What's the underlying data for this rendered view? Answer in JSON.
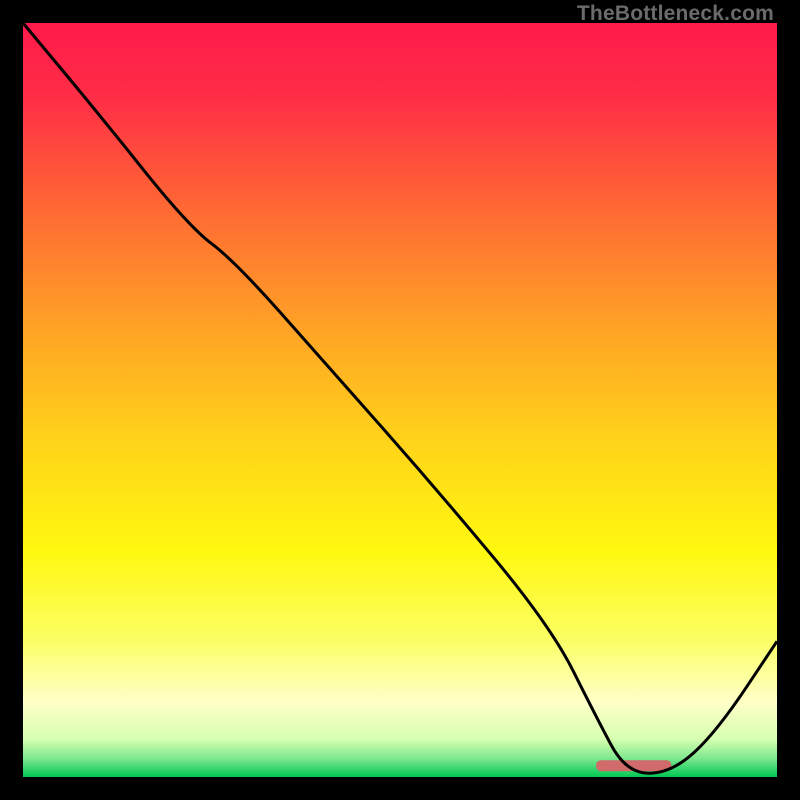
{
  "watermark": "TheBottleneck.com",
  "chart_data": {
    "type": "line",
    "title": "",
    "xlabel": "",
    "ylabel": "",
    "xlim": [
      0,
      100
    ],
    "ylim": [
      0,
      100
    ],
    "grid": false,
    "legend": false,
    "gradient_stops": [
      {
        "offset": 0.0,
        "color": "#ff1a4b"
      },
      {
        "offset": 0.1,
        "color": "#ff2e46"
      },
      {
        "offset": 0.25,
        "color": "#ff6a33"
      },
      {
        "offset": 0.4,
        "color": "#ffa126"
      },
      {
        "offset": 0.55,
        "color": "#ffd21a"
      },
      {
        "offset": 0.7,
        "color": "#fff80f"
      },
      {
        "offset": 0.82,
        "color": "#fbff66"
      },
      {
        "offset": 0.9,
        "color": "#ffffc8"
      },
      {
        "offset": 0.95,
        "color": "#d6ffb0"
      },
      {
        "offset": 0.975,
        "color": "#7fe88f"
      },
      {
        "offset": 1.0,
        "color": "#00c853"
      }
    ],
    "series": [
      {
        "name": "curve",
        "color": "#000000",
        "x": [
          0,
          10,
          22,
          28,
          40,
          55,
          70,
          76,
          80,
          86,
          92,
          100
        ],
        "y": [
          100,
          88,
          73,
          68.5,
          55,
          38,
          20,
          8,
          0.5,
          0.5,
          6,
          18
        ]
      }
    ],
    "marker": {
      "name": "optimal-range",
      "x_start": 76,
      "x_end": 86,
      "y": 1.5,
      "color": "#d16a6a"
    }
  }
}
